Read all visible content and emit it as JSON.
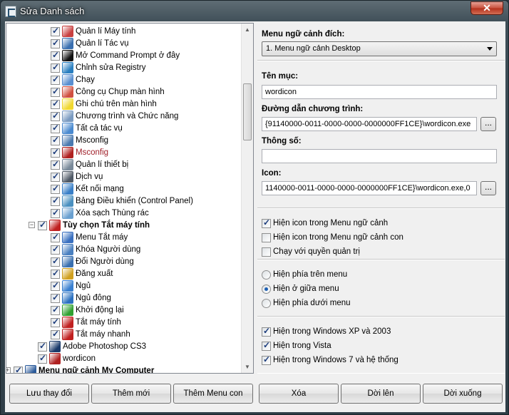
{
  "window": {
    "title": "Sửa Danh sách",
    "close_label": "✕"
  },
  "tree": {
    "items": [
      {
        "label": "Quản lí Máy tính",
        "level": 2,
        "checked": true,
        "icon": "computer-management-icon",
        "color": "#c84040",
        "bold": false,
        "red": false
      },
      {
        "label": "Quản lí Tác vụ",
        "level": 2,
        "checked": true,
        "icon": "task-manager-icon",
        "color": "#3a6fb0",
        "bold": false,
        "red": false
      },
      {
        "label": "Mở Command Prompt ở đây",
        "level": 2,
        "checked": true,
        "icon": "command-prompt-icon",
        "color": "#111111",
        "bold": false,
        "red": false
      },
      {
        "label": "Chỉnh sửa Registry",
        "level": 2,
        "checked": true,
        "icon": "registry-icon",
        "color": "#2a7fc0",
        "bold": false,
        "red": false
      },
      {
        "label": "Chạy",
        "level": 2,
        "checked": true,
        "icon": "run-icon",
        "color": "#5a8fd0",
        "bold": false,
        "red": false
      },
      {
        "label": "Công cụ Chụp màn hình",
        "level": 2,
        "checked": true,
        "icon": "snipping-tool-icon",
        "color": "#d05040",
        "bold": false,
        "red": false
      },
      {
        "label": "Ghi chú trên màn hình",
        "level": 2,
        "checked": true,
        "icon": "sticky-notes-icon",
        "color": "#f0d830",
        "bold": false,
        "red": false
      },
      {
        "label": "Chương trình và Chức năng",
        "level": 2,
        "checked": true,
        "icon": "programs-features-icon",
        "color": "#7a9ac0",
        "bold": false,
        "red": false
      },
      {
        "label": "Tất cả tác vụ",
        "level": 2,
        "checked": true,
        "icon": "all-tasks-icon",
        "color": "#4a8ad0",
        "bold": false,
        "red": false
      },
      {
        "label": "Msconfig",
        "level": 2,
        "checked": true,
        "icon": "msconfig-icon",
        "color": "#4a7ab0",
        "bold": false,
        "red": false
      },
      {
        "label": "Msconfig",
        "level": 2,
        "checked": true,
        "icon": "msconfig-disabled-icon",
        "color": "#b02020",
        "bold": false,
        "red": true
      },
      {
        "label": "Quản lí thiết bị",
        "level": 2,
        "checked": true,
        "icon": "device-manager-icon",
        "color": "#7a8a9a",
        "bold": false,
        "red": false
      },
      {
        "label": "Dịch vụ",
        "level": 2,
        "checked": true,
        "icon": "services-icon",
        "color": "#505a66",
        "bold": false,
        "red": false
      },
      {
        "label": "Kết nối mạng",
        "level": 2,
        "checked": true,
        "icon": "network-icon",
        "color": "#3a80c8",
        "bold": false,
        "red": false
      },
      {
        "label": "Bảng Điều khiển (Control Panel)",
        "level": 2,
        "checked": true,
        "icon": "control-panel-icon",
        "color": "#4a90c0",
        "bold": false,
        "red": false
      },
      {
        "label": "Xóa sạch Thùng rác",
        "level": 2,
        "checked": true,
        "icon": "recycle-bin-icon",
        "color": "#6aa0d0",
        "bold": false,
        "red": false
      },
      {
        "label": "Tùy chọn Tắt máy tính",
        "level": 1,
        "checked": true,
        "icon": "power-options-icon",
        "color": "#c02020",
        "bold": true,
        "red": false,
        "expander": "−"
      },
      {
        "label": "Menu Tắt máy",
        "level": 2,
        "checked": true,
        "icon": "shutdown-menu-icon",
        "color": "#3a70c0",
        "bold": false,
        "red": false
      },
      {
        "label": "Khóa Người dùng",
        "level": 2,
        "checked": true,
        "icon": "lock-user-icon",
        "color": "#4a80c0",
        "bold": false,
        "red": false
      },
      {
        "label": "Đổi Người dùng",
        "level": 2,
        "checked": true,
        "icon": "switch-user-icon",
        "color": "#3a70b0",
        "bold": false,
        "red": false
      },
      {
        "label": "Đăng xuất",
        "level": 2,
        "checked": true,
        "icon": "log-off-icon",
        "color": "#d0a020",
        "bold": false,
        "red": false
      },
      {
        "label": "Ngủ",
        "level": 2,
        "checked": true,
        "icon": "sleep-icon",
        "color": "#3a80d0",
        "bold": false,
        "red": false
      },
      {
        "label": "Ngủ đông",
        "level": 2,
        "checked": true,
        "icon": "hibernate-icon",
        "color": "#2a70c0",
        "bold": false,
        "red": false
      },
      {
        "label": "Khởi động lại",
        "level": 2,
        "checked": true,
        "icon": "restart-icon",
        "color": "#30a030",
        "bold": false,
        "red": false
      },
      {
        "label": "Tắt máy tính",
        "level": 2,
        "checked": true,
        "icon": "shutdown-icon",
        "color": "#c02020",
        "bold": false,
        "red": false
      },
      {
        "label": "Tắt máy nhanh",
        "level": 2,
        "checked": true,
        "icon": "fast-shutdown-icon",
        "color": "#c02020",
        "bold": false,
        "red": false
      },
      {
        "label": "Adobe Photoshop CS3",
        "level": 1,
        "checked": true,
        "icon": "photoshop-icon",
        "color": "#1a3a6a",
        "bold": false,
        "red": false
      },
      {
        "label": "wordicon",
        "level": 1,
        "checked": true,
        "icon": "word-icon",
        "color": "#b02020",
        "bold": false,
        "red": false
      },
      {
        "label": "Menu ngữ cảnh My Computer",
        "level": 0,
        "checked": true,
        "icon": "my-computer-icon",
        "color": "#2a5a9a",
        "bold": true,
        "red": false,
        "expander": "+"
      }
    ]
  },
  "form": {
    "target_menu_label": "Menu ngữ cảnh đích:",
    "target_menu_value": "1. Menu ngữ cảnh Desktop",
    "item_name_label": "Tên mục:",
    "item_name_value": "wordicon",
    "path_label": "Đường dẫn chương trình:",
    "path_value": "{91140000-0011-0000-0000-0000000FF1CE}\\wordicon.exe",
    "params_label": "Thông số:",
    "params_value": "",
    "icon_label": "Icon:",
    "icon_value": "1140000-0011-0000-0000-0000000FF1CE}\\wordicon.exe,0",
    "browse_label": "..."
  },
  "options": {
    "checks": [
      {
        "label": "Hiện icon trong Menu ngữ cảnh",
        "checked": true
      },
      {
        "label": "Hiện icon trong Menu ngữ cảnh con",
        "checked": false
      },
      {
        "label": "Chạy với quyền quản trị",
        "checked": false
      }
    ],
    "position": [
      {
        "label": "Hiện phía trên menu",
        "selected": false
      },
      {
        "label": "Hiện ở giữa menu",
        "selected": true
      },
      {
        "label": "Hiện phía dưới menu",
        "selected": false
      }
    ],
    "os": [
      {
        "label": "Hiện trong Windows XP và 2003",
        "checked": true
      },
      {
        "label": "Hiện trong Vista",
        "checked": true
      },
      {
        "label": "Hiện trong Windows 7 và hệ thống",
        "checked": true
      }
    ]
  },
  "buttons": {
    "save": "Lưu thay đổi",
    "add": "Thêm mới",
    "add_submenu": "Thêm Menu con",
    "delete": "Xóa",
    "move_up": "Dời lên",
    "move_down": "Dời xuống"
  }
}
